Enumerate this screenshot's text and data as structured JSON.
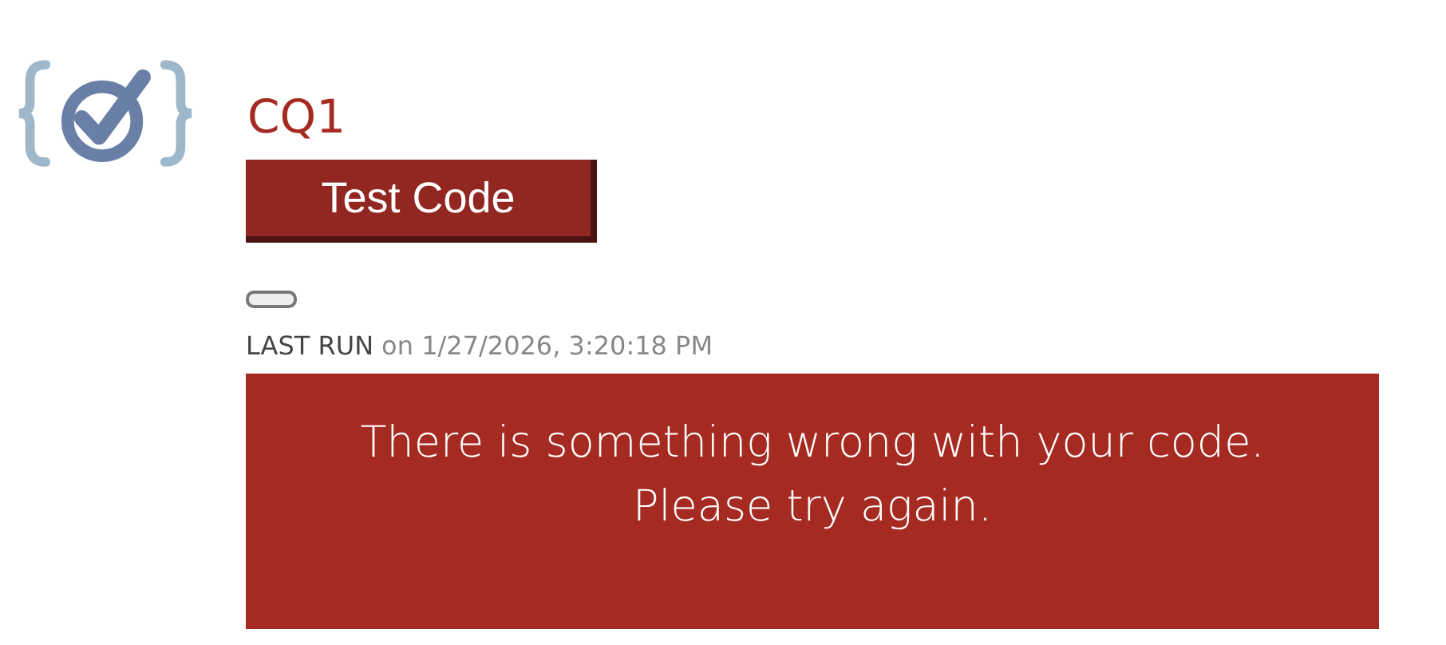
{
  "title": "CQ1",
  "test_button": {
    "label": "Test Code"
  },
  "last_run": {
    "label": "LAST RUN",
    "text": "on 1/27/2026, 3:20:18 PM"
  },
  "result": {
    "lines": [
      "There is something wrong with your code.",
      "Please try again."
    ]
  }
}
